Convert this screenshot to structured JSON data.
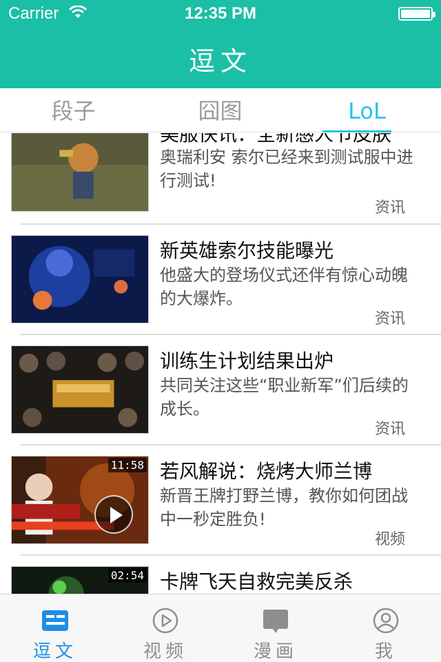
{
  "status_bar": {
    "carrier": "Carrier",
    "time": "12:35 PM"
  },
  "nav": {
    "title": "逗文"
  },
  "tabs": [
    {
      "label": "段子",
      "active": false
    },
    {
      "label": "囧图",
      "active": false
    },
    {
      "label": "LoL",
      "active": true
    }
  ],
  "feed": [
    {
      "title": "美服快讯：全新感人节皮肤",
      "desc": "奥瑞利安 索尔已经来到测试服中进行测试!",
      "tag": "资讯",
      "duration": ""
    },
    {
      "title": "新英雄索尔技能曝光",
      "desc": "他盛大的登场仪式还伴有惊心动魄的大爆炸。",
      "tag": "资讯",
      "duration": ""
    },
    {
      "title": "训练生计划结果出炉",
      "desc": "共同关注这些“职业新军”们后续的成长。",
      "tag": "资讯",
      "duration": ""
    },
    {
      "title": "若风解说：烧烤大师兰博",
      "desc": "新晋王牌打野兰博，教你如何团战中一秒定胜负!",
      "tag": "视频",
      "duration": "11:58"
    },
    {
      "title": "卡牌飞天自救完美反杀",
      "desc": "",
      "tag": "",
      "duration": "02:54"
    }
  ],
  "tabbar": [
    {
      "label": "逗文",
      "icon": "news-icon",
      "active": true
    },
    {
      "label": "视频",
      "icon": "play-circle-icon",
      "active": false
    },
    {
      "label": "漫画",
      "icon": "comic-icon",
      "active": false
    },
    {
      "label": "我",
      "icon": "profile-icon",
      "active": false
    }
  ],
  "colors": {
    "primary": "#1bbfa6",
    "tab_active": "#27c3e8",
    "tabbar_active": "#1e8ee8"
  }
}
